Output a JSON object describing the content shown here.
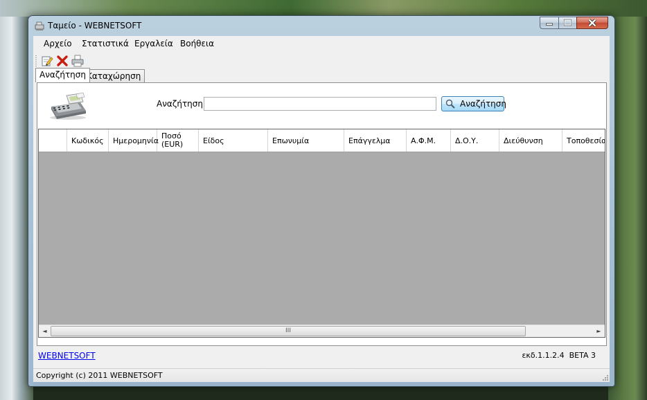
{
  "window": {
    "title": "Ταμείο - WEBNETSOFT"
  },
  "menu": {
    "items": [
      "Αρχείο",
      "Στατιστικά",
      "Εργαλεία",
      "Βοήθεια"
    ]
  },
  "toolbar": {
    "icons": [
      "edit-icon",
      "delete-icon",
      "print-icon"
    ]
  },
  "tabs": {
    "items": [
      "Αναζήτηση",
      "Καταχώρηση"
    ],
    "active": "Αναζήτηση"
  },
  "search": {
    "label": "Αναζήτηση",
    "value": "",
    "button_label": "Αναζήτηση"
  },
  "grid": {
    "columns": [
      "Κωδικός",
      "Ημερομηνία",
      "Ποσό\n(EUR)",
      "Είδος",
      "Επωνυμία",
      "Επάγγελμα",
      "Α.Φ.Μ.",
      "Δ.Ο.Υ.",
      "Διεύθυνση",
      "Τοποθεσία"
    ],
    "rows": [],
    "scroll_glyph_left": "◄",
    "scroll_glyph_right": "►",
    "thumb_grip": "III"
  },
  "footer": {
    "link_text": "WEBNETSOFT",
    "version": "εκδ.1.1.2.4  BETA 3"
  },
  "status": {
    "text": "Copyright (c) 2011 WEBNETSOFT"
  },
  "colors": {
    "grid_background": "#ababab",
    "link": "#0000ee",
    "close_button": "#c44a34"
  }
}
